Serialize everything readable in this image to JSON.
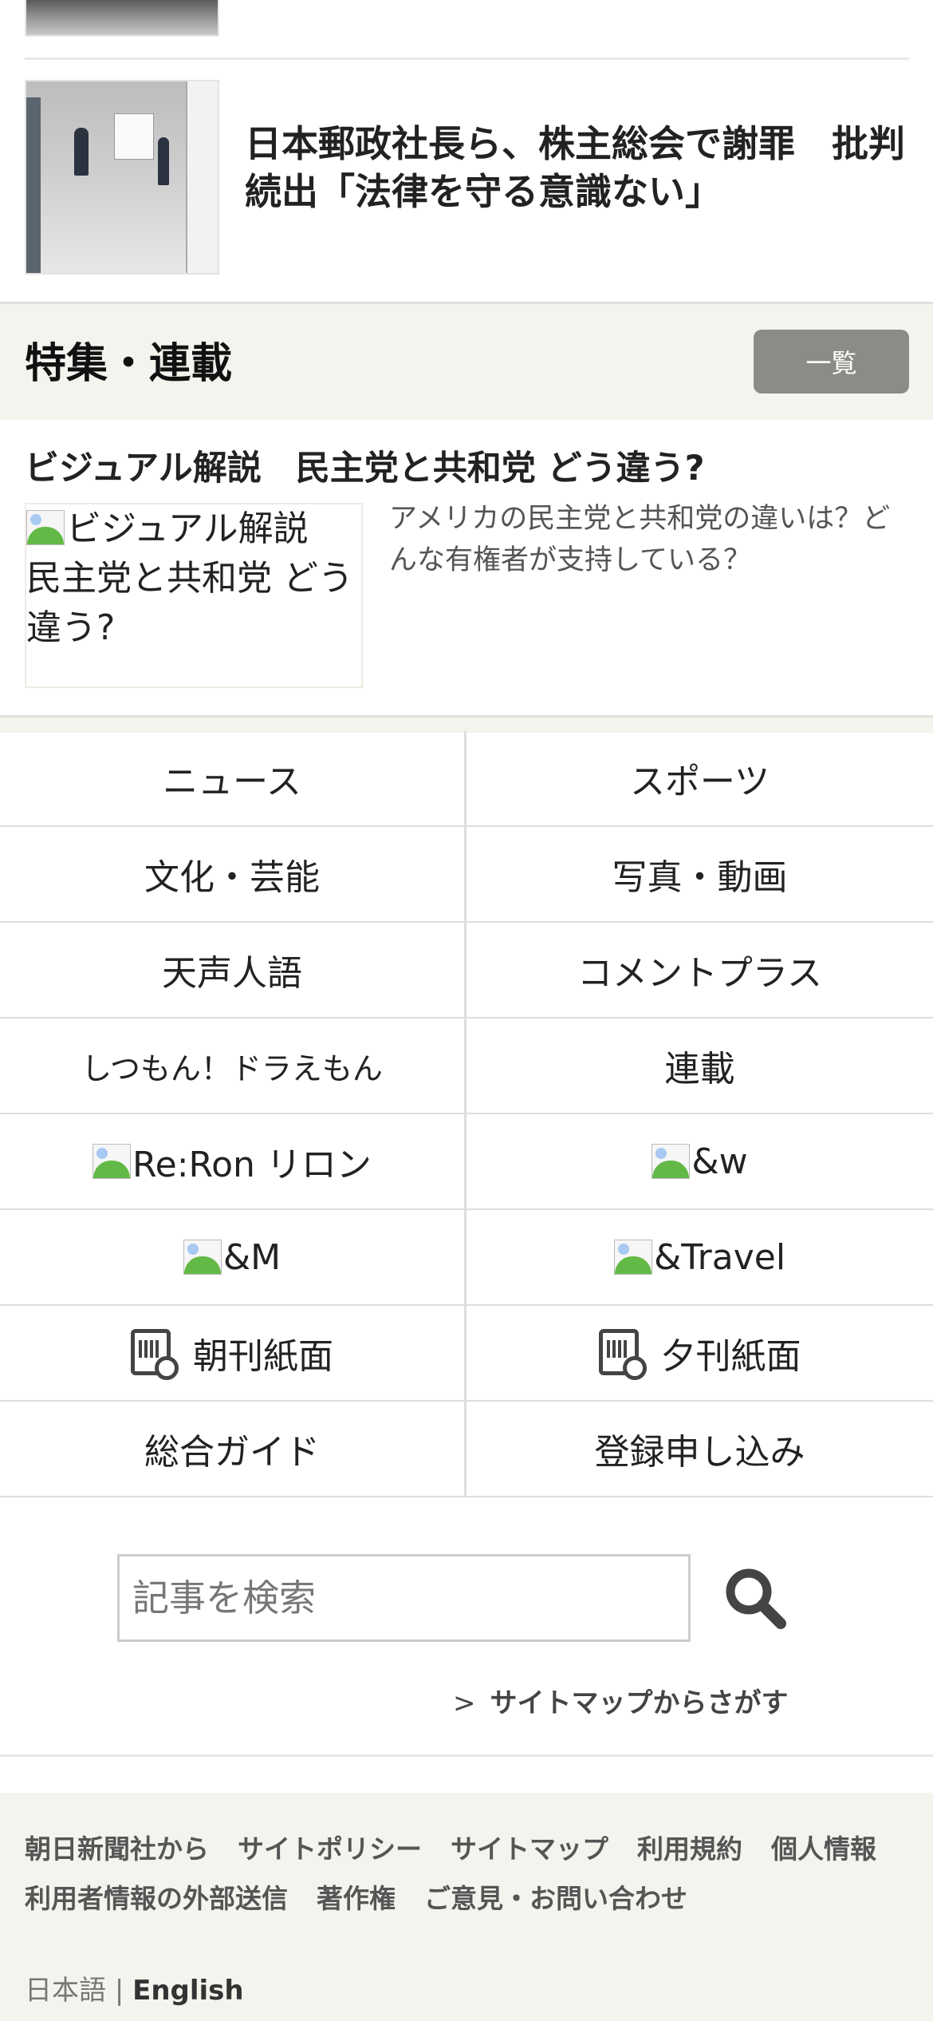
{
  "article": {
    "title": "日本郵政社長ら、株主総会で謝罪　批判続出「法律を守る意識ない」"
  },
  "feature": {
    "section_title": "特集・連載",
    "list_button": "一覧",
    "item_title": "ビジュアル解説　民主党と共和党 どう違う?",
    "thumb_alt": "ビジュアル解説　民主党と共和党 どう違う?",
    "description": "アメリカの民主党と共和党の違いは？どんな有権者が支持している？"
  },
  "nav": {
    "news": "ニュース",
    "sports": "スポーツ",
    "culture": "文化・芸能",
    "photo_video": "写真・動画",
    "tensei_jingo": "天声人語",
    "comment_plus": "コメントプラス",
    "shitsumon_doraemon": "しつもん！ドラえもん",
    "rensai": "連載",
    "reron": "Re:Ron リロン",
    "and_w": "&w",
    "and_m": "&M",
    "and_travel": "&Travel",
    "morning_paper": "朝刊紙面",
    "evening_paper": "夕刊紙面",
    "guide": "総合ガイド",
    "register": "登録申し込み"
  },
  "search": {
    "placeholder": "記事を検索",
    "sitemap_link": "サイトマップからさがす"
  },
  "footer": {
    "links": [
      "朝日新聞社から",
      "サイトポリシー",
      "サイトマップ",
      "利用規約",
      "個人情報",
      "利用者情報の外部送信",
      "著作権",
      "ご意見・お問い合わせ"
    ],
    "lang_ja": "日本語",
    "lang_separator": "|",
    "lang_en": "English"
  }
}
